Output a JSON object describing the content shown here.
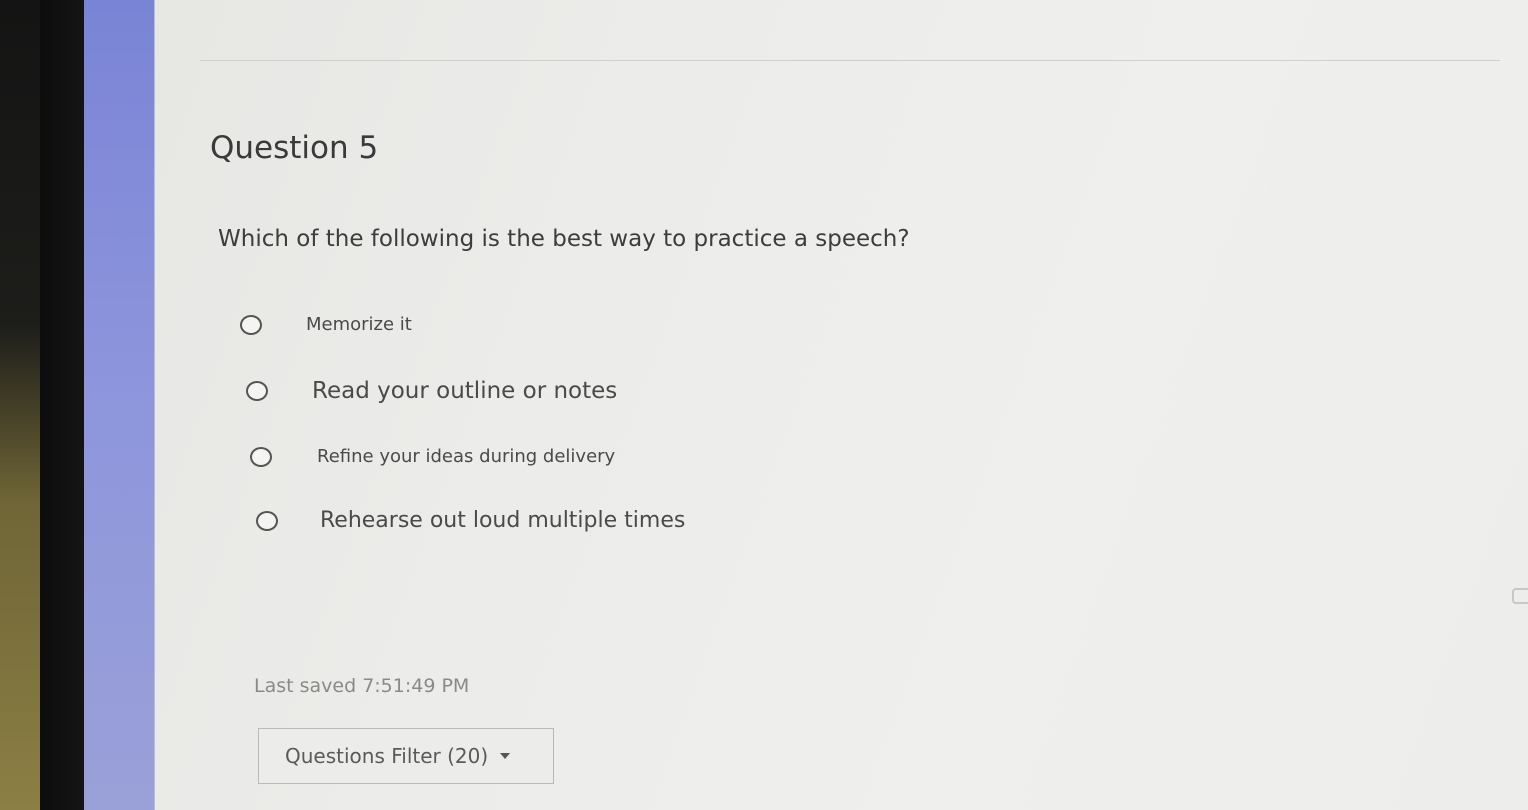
{
  "question": {
    "title": "Question 5",
    "prompt": "Which of the following is the best way to practice a speech?"
  },
  "answers": [
    {
      "label": "Memorize it",
      "selected": false
    },
    {
      "label": "Read your outline or notes",
      "selected": false
    },
    {
      "label": "Refine your ideas during delivery",
      "selected": false
    },
    {
      "label": "Rehearse out loud multiple times",
      "selected": false
    }
  ],
  "status": {
    "last_saved": "Last saved 7:51:49 PM"
  },
  "filter": {
    "label": "Questions Filter (20)",
    "icon": "caret-down-icon"
  },
  "colors": {
    "sidebar_accent": "#8e96dc",
    "page_background": "#ececea",
    "text": "#3d3d3d"
  }
}
